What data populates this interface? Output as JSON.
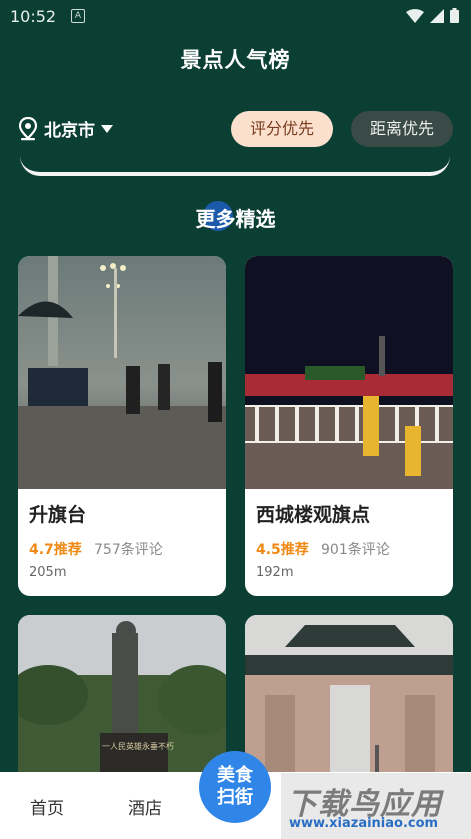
{
  "status": {
    "time": "10:52",
    "a_icon": "A"
  },
  "header": {
    "title": "景点人气榜"
  },
  "location": {
    "city": "北京市"
  },
  "sort": {
    "active": "评分优先",
    "other": "距离优先"
  },
  "section": {
    "title": "更多精选"
  },
  "cards": [
    {
      "name": "升旗台",
      "rating": "4.7推荐",
      "reviews": "757条评论",
      "distance": "205m"
    },
    {
      "name": "西城楼观旗点",
      "rating": "4.5推荐",
      "reviews": "901条评论",
      "distance": "192m"
    },
    {
      "name": "",
      "rating": "",
      "reviews": "",
      "distance": "",
      "statue_text": "一人民英雄永垂不朽"
    },
    {
      "name": "",
      "rating": "",
      "reviews": "",
      "distance": ""
    }
  ],
  "tabs": {
    "home": "首页",
    "hotel": "酒店"
  },
  "fab": {
    "line1": "美食",
    "line2": "扫街"
  },
  "watermark": {
    "big": "下载鸟应用",
    "small": "www.xiazainiao.com"
  },
  "colors": {
    "bg": "#0b3f33",
    "active_chip": "#fbe0cd",
    "rating": "#f08a14",
    "fab": "#2f86e8"
  }
}
